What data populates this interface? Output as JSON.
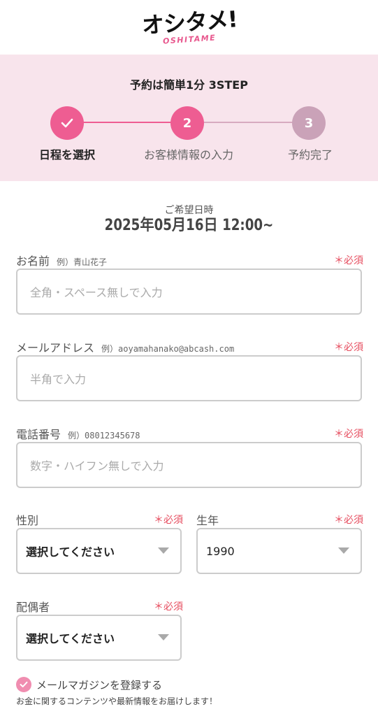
{
  "brand": {
    "logo_main": "オシタメ!",
    "logo_sub": "OSHITAME"
  },
  "steps": {
    "title": "予約は簡単1分 3STEP",
    "items": [
      {
        "label": "日程を選択",
        "state": "done"
      },
      {
        "label": "お客様情報の入力",
        "number": "2",
        "state": "current"
      },
      {
        "label": "予約完了",
        "number": "3",
        "state": "upcoming"
      }
    ]
  },
  "reservation": {
    "label": "ご希望日時",
    "datetime": "2025年05月16日  12:00~"
  },
  "form": {
    "required_label": "＊必須",
    "name": {
      "label": "お名前",
      "example": "例）青山花子",
      "placeholder": "全角・スペース無しで入力"
    },
    "email": {
      "label": "メールアドレス",
      "example": "例）aoyamahanako@abcash.com",
      "placeholder": "半角で入力"
    },
    "phone": {
      "label": "電話番号",
      "example": "例）08012345678",
      "placeholder": "数字・ハイフン無しで入力"
    },
    "gender": {
      "label": "性別",
      "selected": "選択してください"
    },
    "birth_year": {
      "label": "生年",
      "selected": "1990"
    },
    "spouse": {
      "label": "配偶者",
      "selected": "選択してください"
    },
    "newsletter": {
      "label": "メールマガジンを登録する",
      "checked": true,
      "note": "お金に関するコンテンツや最新情報をお届けします！"
    }
  },
  "colors": {
    "accent_pink": "#ee5d92",
    "step_done": "#ee5d92",
    "step_upcoming": "#caa2b8",
    "panel_bg": "#f8e4ec",
    "required_red": "#e64c5e"
  }
}
